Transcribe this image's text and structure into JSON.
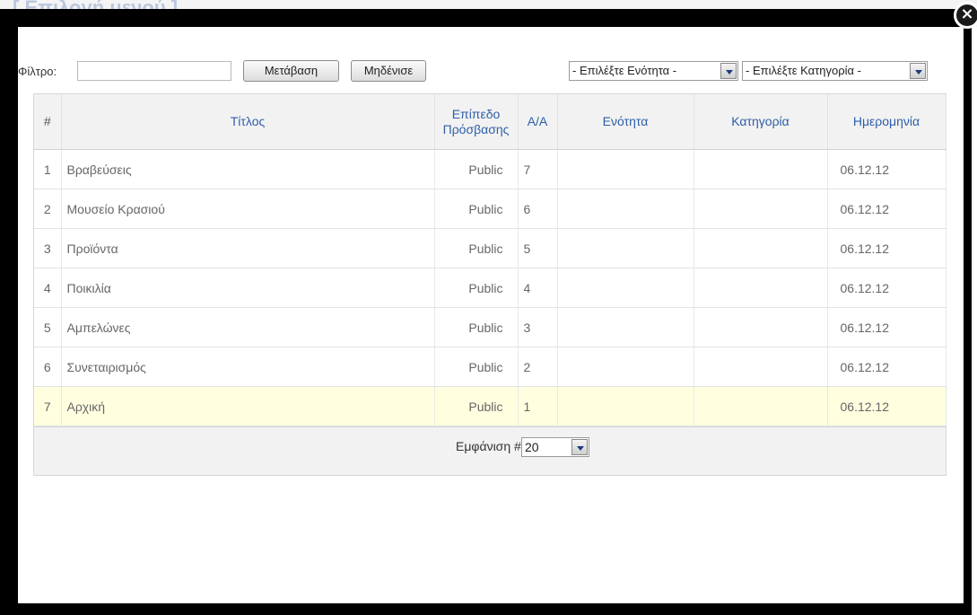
{
  "background": {
    "title": "[ Επιλογή μενού ]"
  },
  "modal": {
    "close_icon": "close-icon"
  },
  "toolbar": {
    "filter_label": "Φίλτρο:",
    "filter_value": "",
    "go_label": "Μετάβαση",
    "reset_label": "Μηδένισε",
    "section_select": "- Επιλέξτε Ενότητα -",
    "category_select": "- Επιλέξτε Κατηγορία -"
  },
  "table": {
    "headers": {
      "num": "#",
      "title": "Τίτλος",
      "access": "Επίπεδο Πρόσβασης",
      "order": "Α/Α",
      "section": "Ενότητα",
      "category": "Κατηγορία",
      "date": "Ημερομηνία"
    },
    "rows": [
      {
        "num": "1",
        "title": "Βραβεύσεις",
        "access": "Public",
        "order": "7",
        "section": "",
        "category": "",
        "date": "06.12.12"
      },
      {
        "num": "2",
        "title": "Μουσείο Κρασιού",
        "access": "Public",
        "order": "6",
        "section": "",
        "category": "",
        "date": "06.12.12"
      },
      {
        "num": "3",
        "title": "Προϊόντα",
        "access": "Public",
        "order": "5",
        "section": "",
        "category": "",
        "date": "06.12.12"
      },
      {
        "num": "4",
        "title": "Ποικιλία",
        "access": "Public",
        "order": "4",
        "section": "",
        "category": "",
        "date": "06.12.12"
      },
      {
        "num": "5",
        "title": "Αμπελώνες",
        "access": "Public",
        "order": "3",
        "section": "",
        "category": "",
        "date": "06.12.12"
      },
      {
        "num": "6",
        "title": "Συνεταιρισμός",
        "access": "Public",
        "order": "2",
        "section": "",
        "category": "",
        "date": "06.12.12"
      },
      {
        "num": "7",
        "title": "Αρχική",
        "access": "Public",
        "order": "1",
        "section": "",
        "category": "",
        "date": "06.12.12"
      }
    ],
    "highlight_row": 7
  },
  "footer": {
    "show_label": "Εμφάνιση #",
    "show_value": "20"
  },
  "colors": {
    "header_link": "#2e5ea8",
    "highlight": "#ffffe0"
  }
}
